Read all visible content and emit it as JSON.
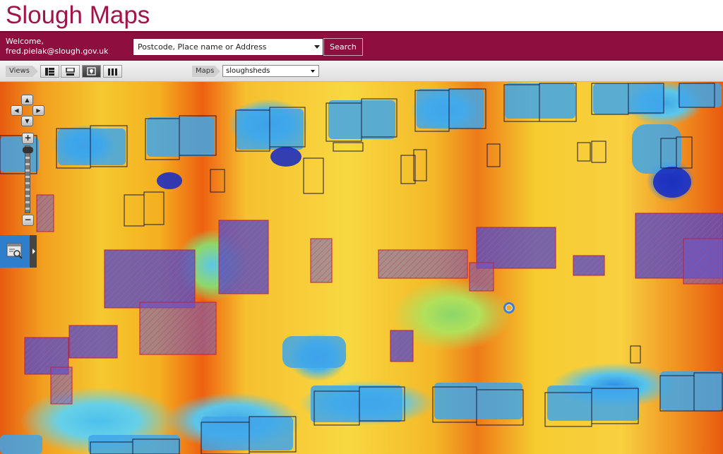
{
  "header": {
    "title": "Slough Maps"
  },
  "topbar": {
    "welcome_line1": "Welcome,",
    "welcome_line2": "fred.pielak@slough.gov.uk",
    "search_placeholder": "Postcode, Place name or Address",
    "search_button": "Search"
  },
  "toolbar": {
    "views_label": "Views",
    "maps_label": "Maps",
    "map_layer": "sloughsheds",
    "view_buttons": [
      "list-view-icon",
      "split-view-icon",
      "map-view-icon",
      "columns-view-icon"
    ],
    "active_view": "map-view-icon"
  },
  "map": {
    "nav_controls": [
      "pan-up-icon",
      "pan-left-icon",
      "pan-right-icon",
      "pan-down-icon"
    ],
    "zoom_in": "+",
    "zoom_out": "−",
    "colors": {
      "hot": "#e85a10",
      "warm": "#f6c830",
      "cool": "#5cc6ea",
      "cold": "#2f8fe0",
      "shed_fill": "#6a5acd",
      "outline": "#1a1a3a",
      "shed_outline": "#c02040"
    }
  }
}
